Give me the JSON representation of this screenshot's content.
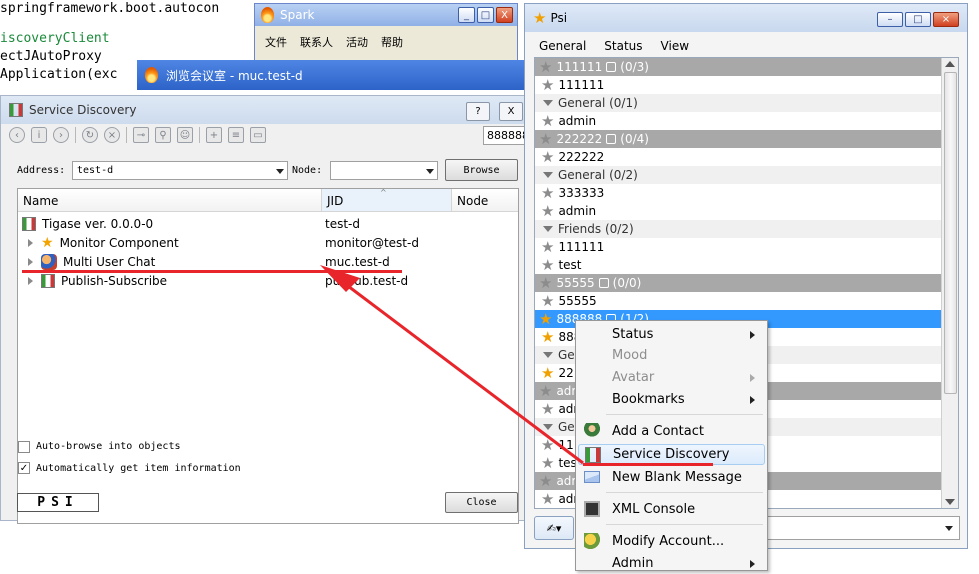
{
  "code_lines": [
    "springframework.boot.autocon",
    "",
    "iscoveryClient",
    "ectJAutoProxy",
    "Application(exc"
  ],
  "spark": {
    "title": "Spark",
    "menu": [
      "文件",
      "联系人",
      "活动",
      "帮助"
    ],
    "controls": [
      "_",
      "□",
      "X"
    ]
  },
  "chatroom": {
    "title": "浏览会议室 - muc.test-d"
  },
  "service_discovery": {
    "title": "Service Discovery",
    "help_label": "?",
    "close_x": "X",
    "toolbar_field_value": "888888",
    "address_label": "Address:",
    "address_value": "test-d",
    "node_label": "Node:",
    "node_value": "",
    "browse_label": "Browse",
    "columns": [
      "Name",
      "JID",
      "Node"
    ],
    "rows": [
      {
        "name": "Tigase ver. 0.0.0-0",
        "jid": "test-d",
        "node": "",
        "icon": "tigase-logo-icon"
      },
      {
        "name": "Monitor Component",
        "jid": "monitor@test-d",
        "node": "",
        "icon": "star-icon"
      },
      {
        "name": "Multi User Chat",
        "jid": "muc.test-d",
        "node": "",
        "icon": "muc-icon"
      },
      {
        "name": "Publish-Subscribe",
        "jid": "pubsub.test-d",
        "node": "",
        "icon": "tigase-logo-icon"
      }
    ],
    "auto_browse_label": "Auto-browse into objects",
    "auto_browse_checked": false,
    "auto_info_label": "Automatically get item information",
    "auto_info_checked": true,
    "logo_text": "PSI",
    "close_label": "Close"
  },
  "psi": {
    "title": "Psi",
    "menu": [
      "General",
      "Status",
      "View"
    ],
    "roster": [
      {
        "type": "account",
        "text": "111111",
        "count": "(0/3)"
      },
      {
        "type": "contact",
        "text": "111111"
      },
      {
        "type": "group",
        "text": "General (0/1)"
      },
      {
        "type": "contact",
        "text": "admin"
      },
      {
        "type": "account",
        "text": "222222",
        "count": "(0/4)"
      },
      {
        "type": "contact",
        "text": "222222"
      },
      {
        "type": "group",
        "text": "General (0/2)"
      },
      {
        "type": "contact",
        "text": "333333"
      },
      {
        "type": "contact",
        "text": "admin"
      },
      {
        "type": "group",
        "text": "Friends (0/2)"
      },
      {
        "type": "contact",
        "text": "111111"
      },
      {
        "type": "contact",
        "text": "test"
      },
      {
        "type": "account",
        "text": "55555",
        "count": "(0/0)"
      },
      {
        "type": "contact",
        "text": "55555"
      },
      {
        "type": "selected",
        "text": "888888",
        "count": "(1/2)"
      },
      {
        "type": "contact-on",
        "text": "888"
      },
      {
        "type": "group",
        "text": "Gen"
      },
      {
        "type": "contact-on",
        "text": "22"
      },
      {
        "type": "account",
        "text": "adm"
      },
      {
        "type": "contact",
        "text": "adr"
      },
      {
        "type": "group",
        "text": "Ger"
      },
      {
        "type": "contact",
        "text": "11"
      },
      {
        "type": "contact",
        "text": "tes"
      },
      {
        "type": "account",
        "text": "adm"
      },
      {
        "type": "contact",
        "text": "adr"
      }
    ]
  },
  "context_menu": {
    "items": [
      {
        "label": "Status",
        "submenu": true,
        "disabled": false,
        "icon": ""
      },
      {
        "label": "Mood",
        "submenu": false,
        "disabled": true,
        "icon": ""
      },
      {
        "label": "Avatar",
        "submenu": true,
        "disabled": true,
        "icon": ""
      },
      {
        "label": "Bookmarks",
        "submenu": true,
        "disabled": false,
        "icon": ""
      },
      {
        "label": "Add a Contact",
        "submenu": false,
        "disabled": false,
        "icon": "add-contact-icon"
      },
      {
        "label": "Service Discovery",
        "submenu": false,
        "disabled": false,
        "icon": "service-discovery-icon",
        "highlighted": true
      },
      {
        "label": "New Blank Message",
        "submenu": false,
        "disabled": false,
        "icon": "envelope-icon"
      },
      {
        "label": "XML Console",
        "submenu": false,
        "disabled": false,
        "icon": "console-icon"
      },
      {
        "label": "Modify Account...",
        "submenu": false,
        "disabled": false,
        "icon": "modify-account-icon"
      },
      {
        "label": "Admin",
        "submenu": true,
        "disabled": false,
        "icon": ""
      }
    ]
  },
  "colors": {
    "annotation_red": "#e8252a",
    "selection_blue": "#3399ff",
    "account_gray": "#a8a8a8"
  }
}
